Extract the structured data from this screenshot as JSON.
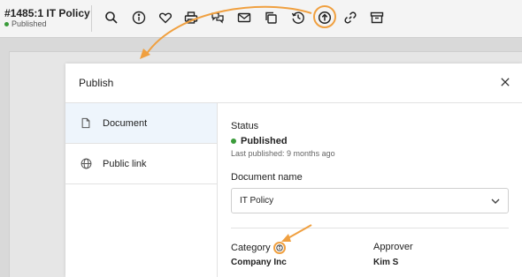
{
  "app": {
    "doc_title": "#1485:1 IT Policy",
    "doc_status": "Published"
  },
  "toolbar": {
    "icons": [
      "search-icon",
      "info-icon",
      "heart-icon",
      "print-icon",
      "comments-icon",
      "mail-icon",
      "copy-icon",
      "history-icon",
      "publish-icon",
      "link-icon",
      "archive-icon"
    ],
    "active": "publish-icon"
  },
  "modal": {
    "title": "Publish",
    "nav": [
      {
        "label": "Document",
        "icon": "document-icon",
        "active": true
      },
      {
        "label": "Public link",
        "icon": "globe-icon",
        "active": false
      }
    ],
    "status_label": "Status",
    "status_value": "Published",
    "last_published": "Last published: 9 months ago",
    "doc_name_label": "Document name",
    "doc_name_value": "IT Policy",
    "category_label": "Category",
    "category_value": "Company Inc",
    "approver_label": "Approver",
    "approver_value": "Kim S"
  },
  "colors": {
    "accent_orange": "#f0a040",
    "status_green": "#3a9b3a",
    "active_nav_bg": "#eef5fc"
  }
}
